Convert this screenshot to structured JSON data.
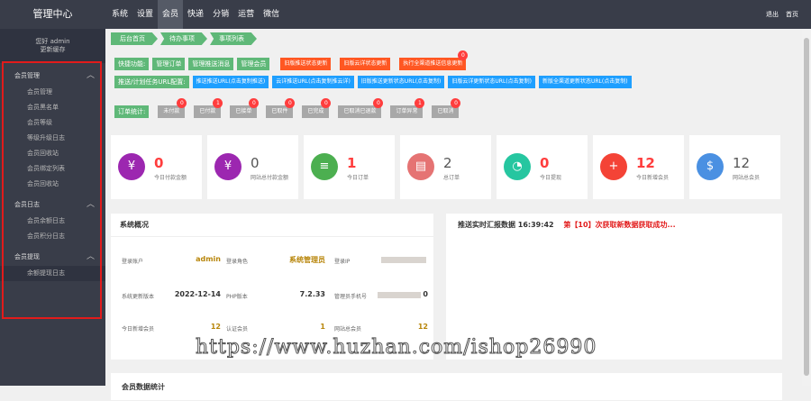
{
  "brand": "管理中心",
  "topnav": [
    "系统",
    "设置",
    "会员",
    "快递",
    "分销",
    "运营",
    "微信"
  ],
  "topright": [
    "退出",
    "首页"
  ],
  "user": {
    "greeting": "您好 admin",
    "refresh": "更新缓存"
  },
  "sidebar": {
    "groups": [
      {
        "title": "会员管理",
        "items": [
          "会员管理",
          "会员黑名单",
          "会员等级",
          "等级升级日志",
          "会员回收站",
          "会员绑定列表",
          "会员回收站"
        ]
      },
      {
        "title": "会员日志",
        "items": [
          "会员余额日志",
          "会员积分日志"
        ]
      },
      {
        "title": "会员提现",
        "items": [
          "余额提现日志"
        ]
      }
    ]
  },
  "crumbs": [
    "后台首页",
    "待办事项",
    "事项列表"
  ],
  "quick": {
    "label": "快捷功能:",
    "green": [
      "管理订单",
      "管理推送消息",
      "管理会员"
    ],
    "orange": [
      "旧版推送状态更新",
      "旧版云详状态更新",
      "执行全渠道推送信息更新"
    ],
    "orange_badge": "0"
  },
  "push": {
    "label": "推送/计划任务URL配置:",
    "buttons": [
      "推送推送URL(点击复制推送)",
      "云详推送URL(点击复制推云详)",
      "旧版推送更新状态URL(点击复制)",
      "旧版云详更新状态URL(点击复制)",
      "新版全渠道更新状态URL(点击复制)"
    ]
  },
  "orders": {
    "label": "订单统计:",
    "items": [
      {
        "name": "未付款",
        "badge": "0"
      },
      {
        "name": "已付款",
        "badge": "1"
      },
      {
        "name": "已接单",
        "badge": "0"
      },
      {
        "name": "已取件",
        "badge": "0"
      },
      {
        "name": "已完成",
        "badge": "0"
      },
      {
        "name": "已取消已退款",
        "badge": "0"
      },
      {
        "name": "订单异常",
        "badge": "1"
      },
      {
        "name": "已取消",
        "badge": "0"
      }
    ]
  },
  "cards": [
    {
      "icon": "¥",
      "num": "0",
      "cap": "今日付款金额",
      "color": "#9c27b0"
    },
    {
      "icon": "¥",
      "num": "0",
      "cap": "网站总付款金额",
      "color": "#9c27b0",
      "plain": true
    },
    {
      "icon": "≡",
      "num": "1",
      "cap": "今日订单",
      "color": "#4caf50"
    },
    {
      "icon": "▤",
      "num": "2",
      "cap": "总订单",
      "color": "#e57373",
      "plain": true
    },
    {
      "icon": "◔",
      "num": "0",
      "cap": "今日提现",
      "color": "#26c6a0"
    },
    {
      "icon": "+",
      "num": "12",
      "cap": "今日新增会员",
      "color": "#f44336"
    },
    {
      "icon": "$",
      "num": "12",
      "cap": "网站总会员",
      "color": "#4a90e2",
      "plain": true
    }
  ],
  "overview": {
    "title": "系统概况",
    "rows": [
      [
        {
          "k": "登录账户",
          "v": "admin"
        },
        {
          "k": "登录角色",
          "v": "系统管理员"
        },
        {
          "k": "登录IP",
          "v": ""
        }
      ],
      [
        {
          "k": "系统更新版本",
          "v": "2022-12-14"
        },
        {
          "k": "PHP版本",
          "v": "7.2.33"
        },
        {
          "k": "管理员手机号",
          "v": "0"
        }
      ],
      [
        {
          "k": "今日新增会员",
          "v": "12"
        },
        {
          "k": "认证会员",
          "v": "1"
        },
        {
          "k": "网站总会员",
          "v": "12"
        }
      ]
    ]
  },
  "realtime": {
    "title": "推送实时汇报数据 16:39:42",
    "msg": "第【10】次获取新数据获取成功..."
  },
  "stats_title": "会员数据统计",
  "watermark": "https://www.huzhan.com/ishop26990"
}
